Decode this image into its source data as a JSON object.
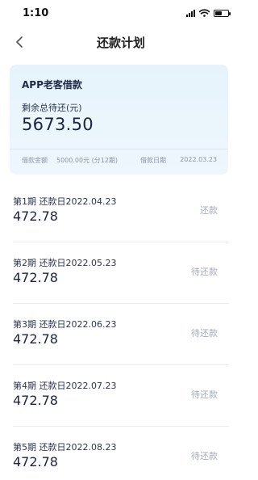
{
  "status_bar": {
    "time": "1:10",
    "battery_level": 0.55
  },
  "nav": {
    "title": "还款计划",
    "back_icon": "chevron-left-icon"
  },
  "summary": {
    "title": "APP老客借款",
    "remaining_label": "剩余总待还(元)",
    "remaining_amount": "5673.50",
    "loan_amount_label": "借款金额",
    "loan_amount_value": "5000.00元 (分12期)",
    "loan_date_label": "借款日期",
    "loan_date_value": "2022.03.23"
  },
  "plans": [
    {
      "header": "第1期   还款日2022.04.23",
      "amount": "472.78",
      "status": "还款"
    },
    {
      "header": "第2期   还款日2022.05.23",
      "amount": "472.78",
      "status": "待还款"
    },
    {
      "header": "第3期   还款日2022.06.23",
      "amount": "472.78",
      "status": "待还款"
    },
    {
      "header": "第4期   还款日2022.07.23",
      "amount": "472.78",
      "status": "待还款"
    },
    {
      "header": "第5期   还款日2022.08.23",
      "amount": "472.78",
      "status": "待还款"
    }
  ]
}
